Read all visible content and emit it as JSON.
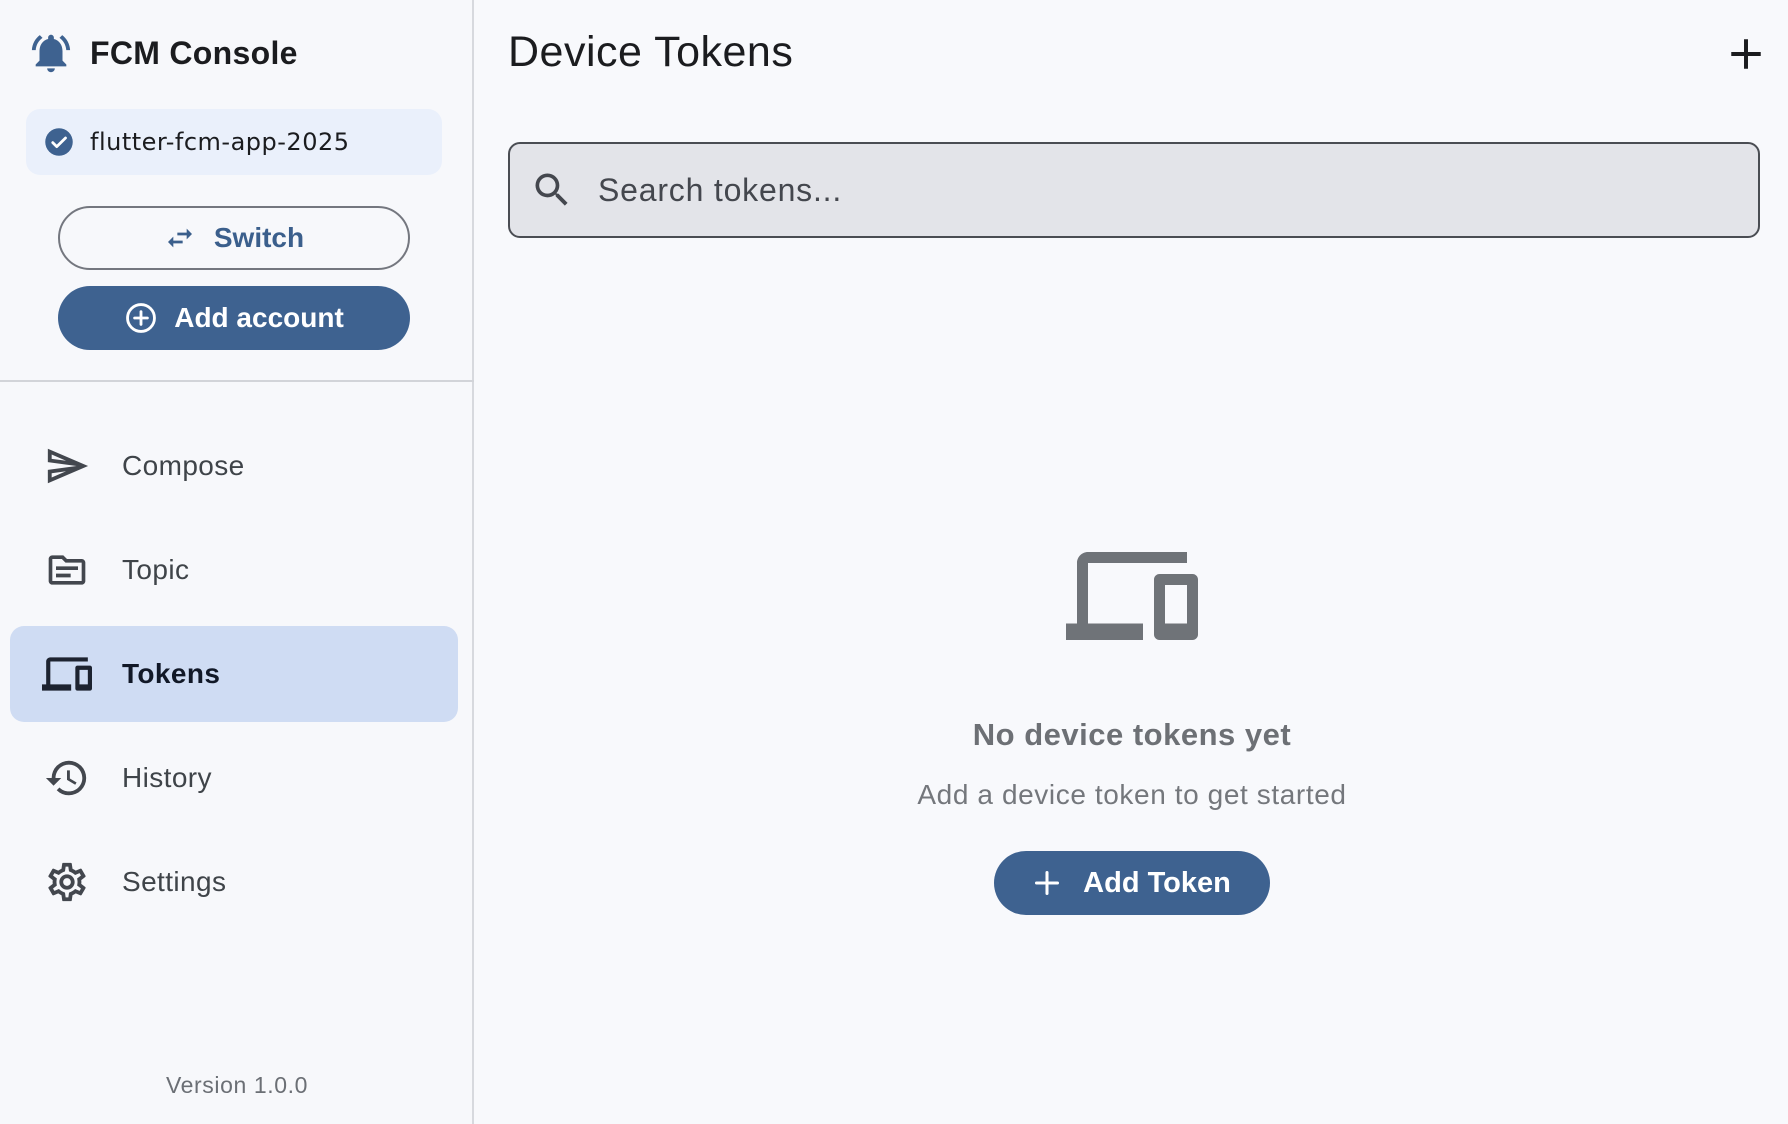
{
  "app": {
    "title": "FCM Console",
    "version": "Version 1.0.0"
  },
  "project": {
    "name": "flutter-fcm-app-2025"
  },
  "account_actions": {
    "switch_label": "Switch",
    "add_account_label": "Add account"
  },
  "nav": {
    "items": [
      {
        "label": "Compose",
        "icon": "send-icon",
        "active": false
      },
      {
        "label": "Topic",
        "icon": "topic-icon",
        "active": false
      },
      {
        "label": "Tokens",
        "icon": "devices-icon",
        "active": true
      },
      {
        "label": "History",
        "icon": "history-icon",
        "active": false
      },
      {
        "label": "Settings",
        "icon": "gear-icon",
        "active": false
      }
    ]
  },
  "main": {
    "title": "Device Tokens",
    "search": {
      "placeholder": "Search tokens...",
      "value": ""
    },
    "empty_state": {
      "title": "No device tokens yet",
      "subtitle": "Add a device token to get started",
      "button_label": "Add Token"
    }
  },
  "colors": {
    "accent": "#3e6290",
    "active_nav": "#cfdcf3",
    "project_chip": "#eaf0fb"
  }
}
